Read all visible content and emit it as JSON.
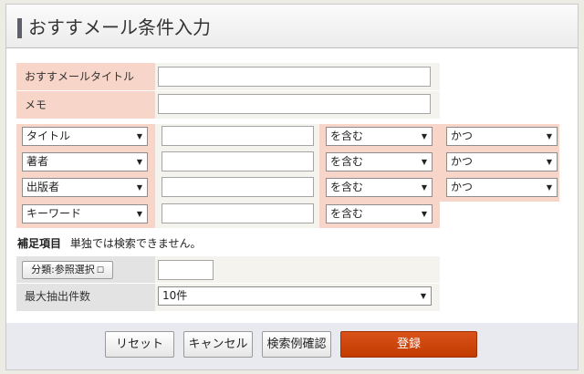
{
  "header": {
    "title": "おすすメール条件入力"
  },
  "basic": {
    "title_label": "おすすメールタイトル",
    "title_value": "",
    "memo_label": "メモ",
    "memo_value": ""
  },
  "conditions": [
    {
      "field": "タイトル",
      "value": "",
      "match": "を含む",
      "logic": "かつ"
    },
    {
      "field": "著者",
      "value": "",
      "match": "を含む",
      "logic": "かつ"
    },
    {
      "field": "出版者",
      "value": "",
      "match": "を含む",
      "logic": "かつ"
    },
    {
      "field": "キーワード",
      "value": "",
      "match": "を含む"
    }
  ],
  "supplement": {
    "heading": "補足項目",
    "note": "単独では検索できません。",
    "category_button": "分類:参照選択",
    "category_value": "",
    "max_label": "最大抽出件数",
    "max_value": "10件"
  },
  "footer": {
    "reset": "リセット",
    "cancel": "キャンセル",
    "preview": "検索例確認",
    "submit": "登録"
  },
  "colors": {
    "label_bg": "#f7d5c8",
    "submit_bg": "#cc4400",
    "footer_bg": "#e9e9f0"
  }
}
